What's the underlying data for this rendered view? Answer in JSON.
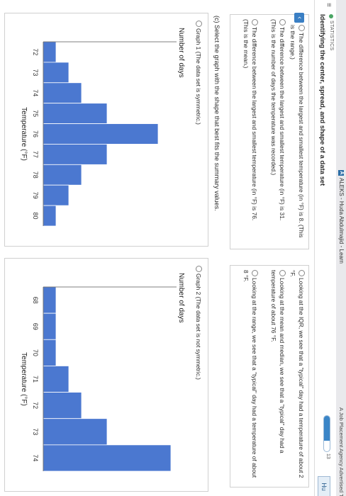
{
  "browser": {
    "tab_title": "ALEKS - Huda Abdulmajid - Learn",
    "tab2_title": "A Job Placement Agency Advertised That"
  },
  "header": {
    "subject": "STATISTICS",
    "topic": "Identifying the center, spread, and shape of a data set",
    "progress_fraction": 0.7,
    "progress_count": "13",
    "help_label": "Hu"
  },
  "options_left": [
    "The difference between the largest and smallest temperature (in °F) is 8. (This is the range.)",
    "The difference between the largest and smallest temperature (in °F) is 31. (This is the number of days the temperature was recorded.)",
    "The difference between the largest and smallest temperature (in °F) is 76. (This is the mean.)"
  ],
  "options_right": [
    "Looking at the IQR, we see that a \"typical\" day had a temperature of about 2 °F.",
    "Looking at the mean and median, we see that a \"typical\" day had a temperature of about 76 °F.",
    "Looking at the range, we see that a \"typical\" day had a temperature of about 8 °F."
  ],
  "part_c_prompt": "(c) Select the graph with the shape that best fits the summary values.",
  "graph1_choice": "Graph 1 (The data set is symmetric.)",
  "graph2_choice": "Graph 2 (The data set is not symmetric.)",
  "chart_data": [
    {
      "type": "bar",
      "title": "",
      "ylabel": "Number of days",
      "xlabel": "Temperature (°F)",
      "categories": [
        "72",
        "73",
        "74",
        "75",
        "76",
        "77",
        "78",
        "79",
        "80"
      ],
      "values": [
        1,
        2,
        3,
        5,
        9,
        5,
        3,
        2,
        1
      ],
      "ylim": [
        0,
        10
      ],
      "grid": false
    },
    {
      "type": "bar",
      "title": "",
      "ylabel": "Number of days",
      "xlabel": "Temperature (°F)",
      "categories": [
        "68",
        "69",
        "70",
        "71",
        "72",
        "73",
        "74"
      ],
      "values": [
        1,
        1,
        1,
        2,
        3,
        5,
        10
      ],
      "ylim": [
        0,
        10
      ],
      "grid": false
    }
  ],
  "colors": {
    "bar": "#4b78d0",
    "accent": "#3a7fc4"
  },
  "icons": {
    "hamburger": "menu-icon",
    "collapse": "chevron-up-icon"
  }
}
